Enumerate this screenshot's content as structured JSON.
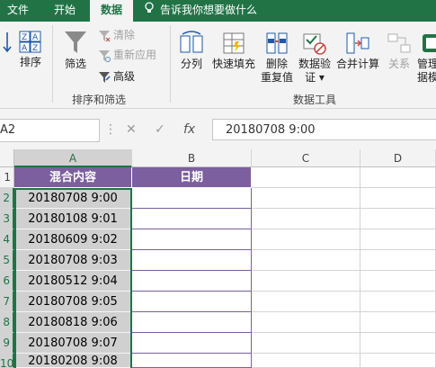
{
  "tabs": [
    {
      "label": "文件",
      "active": false
    },
    {
      "label": "开始",
      "active": false
    },
    {
      "label": "数据",
      "active": true
    }
  ],
  "tell_me": "告诉我你想要做什么",
  "ribbon": {
    "sort_label": "排序",
    "filter_label": "筛选",
    "clear_label": "清除",
    "reapply_label": "重新应用",
    "advanced_label": "高级",
    "sort_filter_group": "排序和筛选",
    "split_label": "分列",
    "flash_fill_label": "快速填充",
    "remove_dup_label_1": "删除",
    "remove_dup_label_2": "重复值",
    "validation_label_1": "数据验",
    "validation_label_2": "证 ▾",
    "consolidate_label": "合并计算",
    "relationships_label": "关系",
    "manage_label_1": "管理",
    "manage_label_2": "据模",
    "data_tools_group": "数据工具"
  },
  "formula_bar": {
    "name_box": "A2",
    "cancel": "✕",
    "enter": "✓",
    "fx": "fx",
    "value": "20180708 9:00"
  },
  "columns": [
    "A",
    "B",
    "C",
    "D"
  ],
  "row_numbers": [
    "1",
    "2",
    "3",
    "4",
    "5",
    "6",
    "7",
    "8",
    "9",
    "10"
  ],
  "headers": {
    "a": "混合内容",
    "b": "日期"
  },
  "rows": [
    "20180708 9:00",
    "20180108 9:01",
    "20180609 9:02",
    "20180708 9:03",
    "20180512 9:04",
    "20180708 9:05",
    "20180818 9:06",
    "20180708 9:07",
    "20180208 9:08"
  ],
  "colors": {
    "accent": "#217346",
    "header_fill": "#7b5f9e",
    "selection_fill": "#d0d0d0"
  }
}
